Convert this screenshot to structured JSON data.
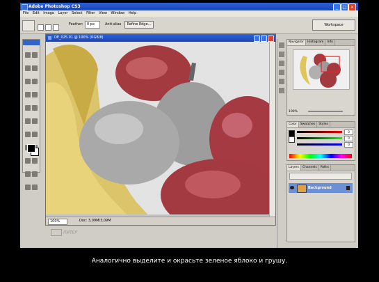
{
  "window": {
    "title": "Adobe Photoshop CS3"
  },
  "menu": [
    "File",
    "Edit",
    "Image",
    "Layer",
    "Select",
    "Filter",
    "View",
    "Window",
    "Help"
  ],
  "options_bar": {
    "feather_label": "Feather:",
    "feather_value": "0 px",
    "antialias_label": "Anti-alias",
    "refine_edge_label": "Refine Edge...",
    "workspace_label": "Workspace"
  },
  "document": {
    "title": "DE_025.01 @ 100% (RGB/8)",
    "zoom": "100%",
    "doc_size": "Doc: 3,09M/3,09M"
  },
  "panels": {
    "navigator": {
      "tabs": [
        "Navigator",
        "Histogram",
        "Info"
      ],
      "zoom": "100%"
    },
    "color": {
      "tabs": [
        "Color",
        "Swatches",
        "Styles"
      ],
      "rgb_values": [
        "0",
        "0",
        "0"
      ]
    },
    "layers": {
      "tabs": [
        "Layers",
        "Channels",
        "Paths"
      ],
      "layer_name": "Background"
    }
  },
  "watermark": "ПИТЕР",
  "subtitle": "Аналогично выделите и окрасьте зеленое яблоко и грушу."
}
